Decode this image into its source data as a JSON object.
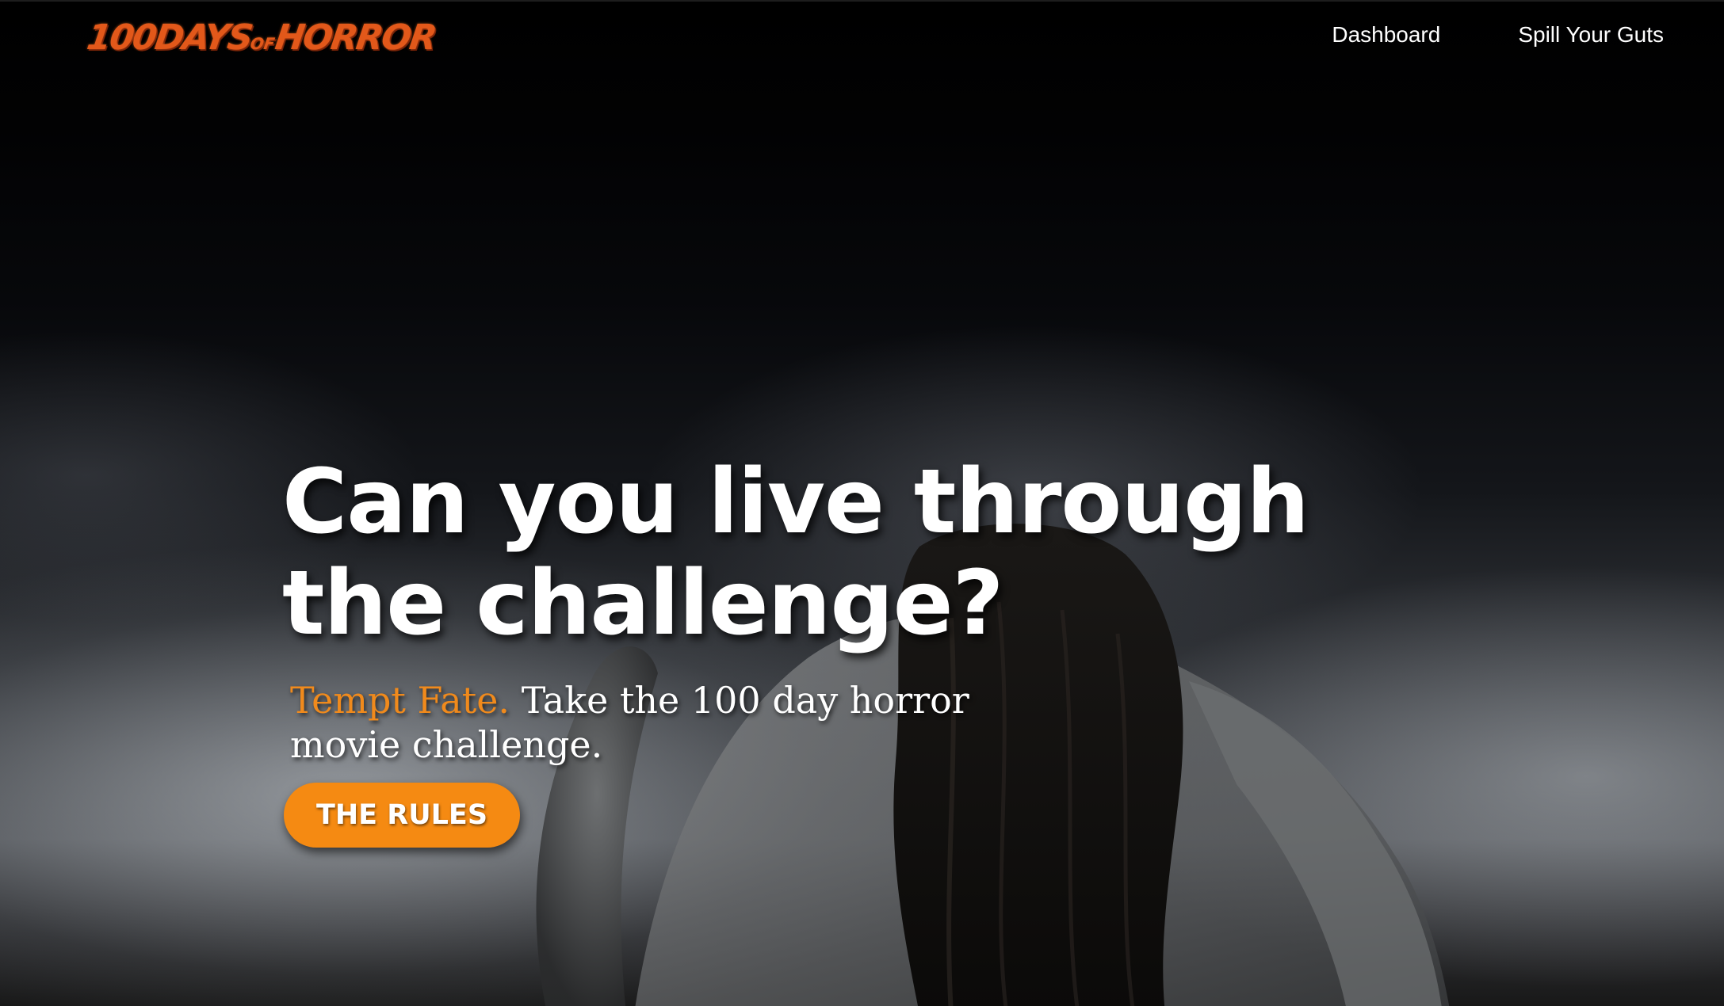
{
  "header": {
    "logo_main": "100DAYS",
    "logo_of": "OF",
    "logo_end": "HORROR",
    "nav": [
      {
        "label": "Dashboard"
      },
      {
        "label": "Spill Your Guts"
      }
    ]
  },
  "hero": {
    "headline": "Can you live through the challenge?",
    "tagline_accent": "Tempt Fate.",
    "tagline_rest": "Take the 100 day horror movie challenge.",
    "cta_label": "THE RULES"
  },
  "colors": {
    "accent": "#f08a1c",
    "button": "#f58a12",
    "logo": "#e2581a"
  }
}
